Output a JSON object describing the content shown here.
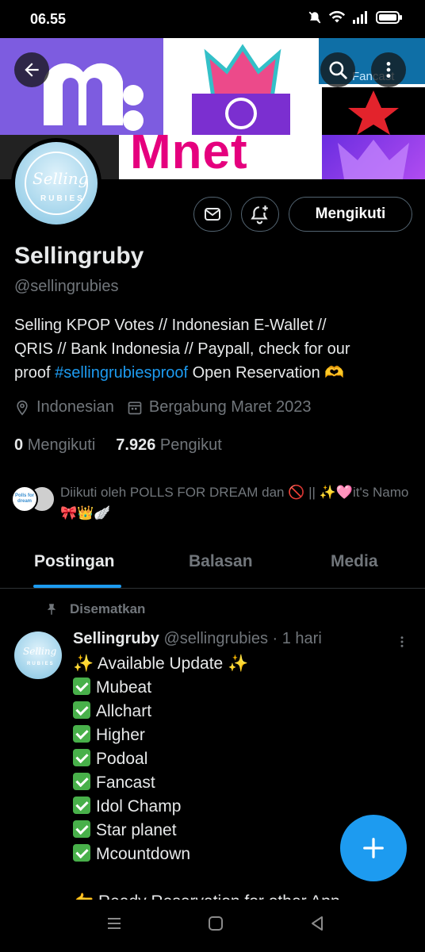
{
  "status": {
    "time": "06.55"
  },
  "banner": {
    "tile_m_letter": "m",
    "mnet_text": "Mnet",
    "fancast_text": "Fancast"
  },
  "profile": {
    "avatar_text_top": "Selling",
    "avatar_text_bottom": "RUBIES",
    "follow_label": "Mengikuti",
    "display_name": "Sellingruby",
    "handle": "@sellingrubies",
    "bio_line1": "Selling KPOP Votes // Indonesian E-Wallet //",
    "bio_line2": "QRIS // Bank Indonesia // Paypall, check for our",
    "bio_line3_before": "proof ",
    "bio_hashtag": "#sellingrubiesproof",
    "bio_line3_after": "  Open Reservation 🫶",
    "location": "Indonesian",
    "joined": "Bergabung Maret 2023",
    "following_count": "0",
    "following_label": "Mengikuti",
    "followers_count": "7.926",
    "followers_label": "Pengikut",
    "followed_by_text": "Diikuti oleh POLLS FOR DREAM dan 🚫 || ✨🩷it's Namo🎀👑🪽",
    "fb_avatar_text": "Polls for dream"
  },
  "tabs": [
    {
      "label": "Postingan"
    },
    {
      "label": "Balasan"
    },
    {
      "label": "Media"
    }
  ],
  "post": {
    "pinned_label": "Disematkan",
    "name": "Sellingruby",
    "handle": "@sellingrubies",
    "dot": "·",
    "time": "1 hari",
    "headline": "Available Update",
    "items": [
      "Mubeat",
      "Allchart",
      "Higher",
      "Podoal",
      "Fancast",
      "Idol Champ",
      "Star planet",
      "Mcountdown"
    ],
    "footer": "👉 Ready Reservation for other App"
  },
  "colors": {
    "accent": "#1d9bf0",
    "muted": "#71767b",
    "text": "#e7e9ea"
  }
}
